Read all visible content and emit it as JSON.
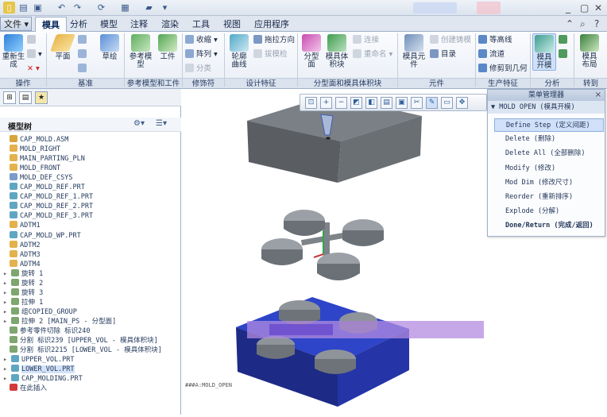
{
  "quick_access": {
    "window_title": ""
  },
  "menu": {
    "file": "文件",
    "tabs": [
      "模具",
      "分析",
      "模型",
      "注释",
      "渲染",
      "工具",
      "视图",
      "应用程序"
    ],
    "active_tab": "模具"
  },
  "ribbon": {
    "groups": [
      "操作",
      "基准",
      "参考模型和工件",
      "修饰符",
      "设计特征",
      "分型面和模具体积块",
      "元件",
      "生产特征",
      "分析",
      "转到"
    ],
    "buttons": {
      "regenerate": "重新生\n成",
      "plane": "平面",
      "sketch": "草绘",
      "ref_model": "参考模\n型",
      "workpiece": "工件",
      "shrink": "收缩",
      "pattern": "阵列",
      "classify": "分类",
      "contour_curve": "轮廓\n曲线",
      "draft_direction": "拖拉方向",
      "draft_check": "拔模检",
      "parting_surface": "分型\n面",
      "mold_volume": "模具体\n积块",
      "connect": "连接",
      "rename": "重命名",
      "mold_component": "模具元\n件",
      "create_casting": "创建铸模",
      "catalog": "目录",
      "contour_line": "等高线",
      "runner": "流道",
      "trim_to_geometry": "修剪到几何",
      "mold_open": "模具\n开模",
      "mold_layout": "模具\n布局"
    }
  },
  "model_tree": {
    "title": "模型树",
    "items": [
      {
        "label": "CAP_MOLD.ASM",
        "type": "asm",
        "expand": ""
      },
      {
        "label": "MOLD_RIGHT",
        "type": "datum",
        "expand": ""
      },
      {
        "label": "MAIN_PARTING_PLN",
        "type": "datum",
        "expand": ""
      },
      {
        "label": "MOLD_FRONT",
        "type": "datum",
        "expand": ""
      },
      {
        "label": "MOLD_DEF_CSYS",
        "type": "csys",
        "expand": ""
      },
      {
        "label": "CAP_MOLD_REF.PRT",
        "type": "part",
        "expand": ""
      },
      {
        "label": "CAP_MOLD_REF_1.PRT",
        "type": "part",
        "expand": ""
      },
      {
        "label": "CAP_MOLD_REF_2.PRT",
        "type": "part",
        "expand": ""
      },
      {
        "label": "CAP_MOLD_REF_3.PRT",
        "type": "part",
        "expand": ""
      },
      {
        "label": "ADTM1",
        "type": "datum",
        "expand": ""
      },
      {
        "label": "CAP_MOLD_WP.PRT",
        "type": "part",
        "expand": ""
      },
      {
        "label": "ADTM2",
        "type": "datum",
        "expand": ""
      },
      {
        "label": "ADTM3",
        "type": "datum",
        "expand": ""
      },
      {
        "label": "ADTM4",
        "type": "datum",
        "expand": ""
      },
      {
        "label": "旋转 1",
        "type": "feat",
        "expand": "▸"
      },
      {
        "label": "旋转 2",
        "type": "feat",
        "expand": "▸"
      },
      {
        "label": "旋转 3",
        "type": "feat",
        "expand": "▸"
      },
      {
        "label": "拉伸 1",
        "type": "feat",
        "expand": "▸"
      },
      {
        "label": "组COPIED_GROUP",
        "type": "feat",
        "expand": "▸"
      },
      {
        "label": "拉伸 2 [MAIN_PS - 分型面]",
        "type": "feat",
        "expand": "▸"
      },
      {
        "label": "参考零件切除 标识240",
        "type": "feat",
        "expand": ""
      },
      {
        "label": "分割 标识239 [UPPER_VOL - 模具体积块]",
        "type": "feat",
        "expand": ""
      },
      {
        "label": "分割 标识2215 [LOWER_VOL - 模具体积块]",
        "type": "feat",
        "expand": ""
      },
      {
        "label": "UPPER_VOL.PRT",
        "type": "part",
        "expand": "▸"
      },
      {
        "label": "LOWER_VOL.PRT",
        "type": "part",
        "expand": "▸",
        "selected": true
      },
      {
        "label": "CAP_MOLDING.PRT",
        "type": "part",
        "expand": "▸"
      },
      {
        "label": "在此插入",
        "type": "insert",
        "expand": ""
      }
    ]
  },
  "menu_manager": {
    "title": "菜单管理器",
    "section": "MOLD OPEN (模具开模)",
    "items": [
      {
        "label": "Define Step (定义间距)",
        "active": true
      },
      {
        "label": "Delete (删除)"
      },
      {
        "label": "Delete All (全部删除)"
      },
      {
        "label": "Modify (修改)"
      },
      {
        "label": "Mod Dim (修改尺寸)"
      },
      {
        "label": "Reorder (重新排序)"
      },
      {
        "label": "Explode (分解)"
      },
      {
        "label": "Done/Return (完成/返回)",
        "bold": true
      }
    ]
  },
  "viewport": {
    "caption": "###A:MOLD_OPEN"
  },
  "colors": {
    "ribbon_bg": "#eef2f8",
    "selection": "#cfe0f8",
    "mold_top": "#6e7378",
    "mold_base": "#2a3fc2",
    "caps": "#8d9399"
  }
}
